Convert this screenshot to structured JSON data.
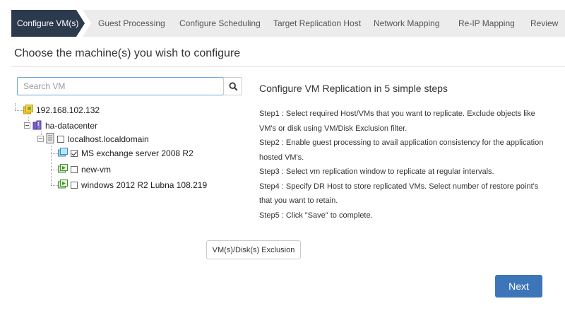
{
  "wizard": {
    "steps": [
      {
        "label": "Configure VM(s)"
      },
      {
        "label": "Guest Processing"
      },
      {
        "label": "Configure Scheduling"
      },
      {
        "label": "Target Replication Host"
      },
      {
        "label": "Network Mapping"
      },
      {
        "label": "Re-IP Mapping"
      },
      {
        "label": "Review"
      }
    ],
    "active_step": "Configure VM(s)"
  },
  "page": {
    "title": "Choose the machine(s) you wish to configure"
  },
  "search": {
    "placeholder": "Search VM",
    "value": ""
  },
  "tree": {
    "host": {
      "label": "192.168.102.132"
    },
    "datacenter": {
      "label": "ha-datacenter"
    },
    "server": {
      "label": "localhost.localdomain",
      "checked": false
    },
    "vms": [
      {
        "label": "MS exchange server 2008 R2",
        "checked": true
      },
      {
        "label": "new-vm",
        "checked": false
      },
      {
        "label": "windows 2012 R2 Lubna 108.219",
        "checked": false
      }
    ]
  },
  "instructions": {
    "title": "Configure VM Replication in 5 simple steps",
    "steps": [
      "Step1 : Select required Host/VMs that you want to replicate. Exclude objects like VM's or disk using VM/Disk Exclusion filter.",
      "Step2 : Enable guest processing to avail application consistency for the application hosted VM's.",
      "Step3 : Select vm replication window to replicate at regular intervals.",
      "Step4 : Specify DR Host to store replicated VMs. Select number of restore point's that you want to retain.",
      "Step5 : Click \"Save\" to complete."
    ]
  },
  "buttons": {
    "exclusion": "VM(s)/Disk(s) Exclusion",
    "next": "Next"
  },
  "colors": {
    "active_step_bg": "#2b3a4d",
    "inactive_step_bg": "#ececec",
    "primary_button": "#3d76b8",
    "search_border": "#6aa7de"
  }
}
